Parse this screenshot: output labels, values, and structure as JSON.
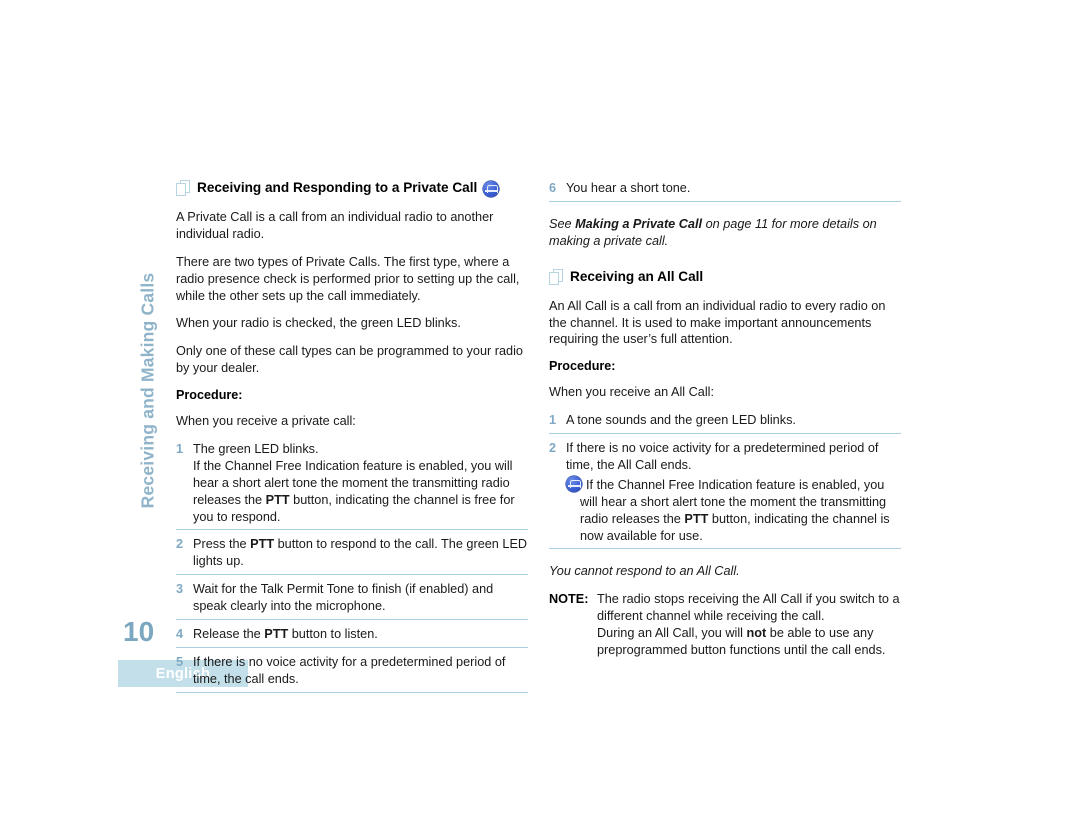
{
  "sidebar": {
    "chapter_tab": "Receiving and Making Calls",
    "page_number": "10",
    "language": "English"
  },
  "icons": {
    "heading_bullet": "stacked-pages-icon",
    "channel_free": "channel-free-radio-icon"
  },
  "colors": {
    "accent_blue": "#7fa9c4",
    "rule_blue": "#a9cfe2",
    "lang_box_bg": "#c3e0ea",
    "page_number": "#7ba7c0",
    "icon_blue": "#3b5fd4"
  },
  "left_column": {
    "heading": "Receiving and Responding to a Private Call",
    "paragraphs": [
      "A Private Call is a call from an individual radio to another individual radio.",
      "There are two types of Private Calls. The first type, where a radio presence check is performed prior to setting up the call, while the other sets up the call immediately.",
      "When your radio is checked, the green LED blinks.",
      "Only one of these call types can be programmed to your radio by your dealer."
    ],
    "procedure_label": "Procedure:",
    "procedure_intro": "When you receive a private call:",
    "steps": [
      {
        "number": "1",
        "lines": [
          "The green LED blinks.",
          "If the Channel Free Indication feature is enabled, you will hear a short alert tone the moment the transmitting radio releases the PTT button, indicating the channel is free for you to respond."
        ],
        "bold_terms": [
          "PTT"
        ]
      },
      {
        "number": "2",
        "lines": [
          "Press the PTT button to respond to the call. The green LED lights up."
        ],
        "bold_terms": [
          "PTT"
        ]
      },
      {
        "number": "3",
        "lines": [
          "Wait for the Talk Permit Tone to finish (if enabled) and speak clearly into the microphone."
        ],
        "bold_terms": []
      },
      {
        "number": "4",
        "lines": [
          "Release the PTT button to listen."
        ],
        "bold_terms": [
          "PTT"
        ]
      },
      {
        "number": "5",
        "lines": [
          "If there is no voice activity for a predetermined period of time, the call ends."
        ],
        "bold_terms": []
      }
    ]
  },
  "right_column": {
    "continued_step": {
      "number": "6",
      "text": "You hear a short tone."
    },
    "cross_reference": {
      "prefix": "See ",
      "bold_title": "Making a Private Call",
      "suffix": " on page 11 for more details on making a private call."
    },
    "heading": "Receiving an All Call",
    "paragraphs": [
      "An All Call is a call from an individual radio to every radio on the channel. It is used to make important announcements requiring the user’s full attention."
    ],
    "procedure_label": "Procedure:",
    "procedure_intro": "When you receive an All Call:",
    "steps": [
      {
        "number": "1",
        "text": "A tone sounds and the green LED blinks."
      },
      {
        "number": "2",
        "text": "If there is no voice activity for a predetermined period of time, the All Call ends.",
        "sub_note": {
          "icon": "channel-free-radio-icon",
          "prefix": "If the Channel Free Indication feature is enabled, you will hear a short alert tone the moment the transmitting radio releases the ",
          "bold": "PTT",
          "suffix": " button, indicating the channel is now available for use."
        }
      }
    ],
    "italic_note": "You cannot respond to an All Call.",
    "note": {
      "label": "NOTE:",
      "line1": "The radio stops receiving the All Call if you switch to a different channel while receiving the call.",
      "line2_prefix": "During an All Call, you will ",
      "line2_bold": "not",
      "line2_suffix": " be able to use any preprogrammed button functions until the call ends."
    }
  }
}
